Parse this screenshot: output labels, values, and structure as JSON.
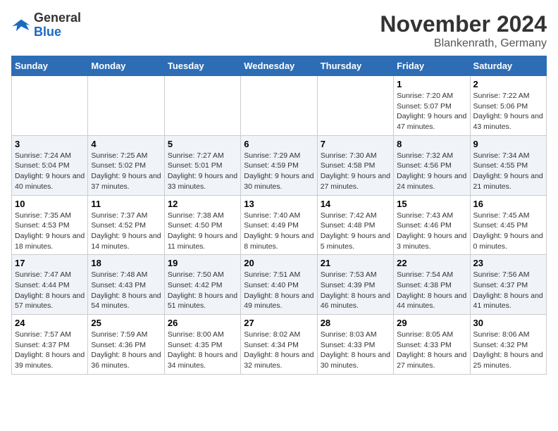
{
  "logo": {
    "general": "General",
    "blue": "Blue"
  },
  "header": {
    "month": "November 2024",
    "location": "Blankenrath, Germany"
  },
  "days_of_week": [
    "Sunday",
    "Monday",
    "Tuesday",
    "Wednesday",
    "Thursday",
    "Friday",
    "Saturday"
  ],
  "weeks": [
    [
      {
        "day": "",
        "info": ""
      },
      {
        "day": "",
        "info": ""
      },
      {
        "day": "",
        "info": ""
      },
      {
        "day": "",
        "info": ""
      },
      {
        "day": "",
        "info": ""
      },
      {
        "day": "1",
        "info": "Sunrise: 7:20 AM\nSunset: 5:07 PM\nDaylight: 9 hours and 47 minutes."
      },
      {
        "day": "2",
        "info": "Sunrise: 7:22 AM\nSunset: 5:06 PM\nDaylight: 9 hours and 43 minutes."
      }
    ],
    [
      {
        "day": "3",
        "info": "Sunrise: 7:24 AM\nSunset: 5:04 PM\nDaylight: 9 hours and 40 minutes."
      },
      {
        "day": "4",
        "info": "Sunrise: 7:25 AM\nSunset: 5:02 PM\nDaylight: 9 hours and 37 minutes."
      },
      {
        "day": "5",
        "info": "Sunrise: 7:27 AM\nSunset: 5:01 PM\nDaylight: 9 hours and 33 minutes."
      },
      {
        "day": "6",
        "info": "Sunrise: 7:29 AM\nSunset: 4:59 PM\nDaylight: 9 hours and 30 minutes."
      },
      {
        "day": "7",
        "info": "Sunrise: 7:30 AM\nSunset: 4:58 PM\nDaylight: 9 hours and 27 minutes."
      },
      {
        "day": "8",
        "info": "Sunrise: 7:32 AM\nSunset: 4:56 PM\nDaylight: 9 hours and 24 minutes."
      },
      {
        "day": "9",
        "info": "Sunrise: 7:34 AM\nSunset: 4:55 PM\nDaylight: 9 hours and 21 minutes."
      }
    ],
    [
      {
        "day": "10",
        "info": "Sunrise: 7:35 AM\nSunset: 4:53 PM\nDaylight: 9 hours and 18 minutes."
      },
      {
        "day": "11",
        "info": "Sunrise: 7:37 AM\nSunset: 4:52 PM\nDaylight: 9 hours and 14 minutes."
      },
      {
        "day": "12",
        "info": "Sunrise: 7:38 AM\nSunset: 4:50 PM\nDaylight: 9 hours and 11 minutes."
      },
      {
        "day": "13",
        "info": "Sunrise: 7:40 AM\nSunset: 4:49 PM\nDaylight: 9 hours and 8 minutes."
      },
      {
        "day": "14",
        "info": "Sunrise: 7:42 AM\nSunset: 4:48 PM\nDaylight: 9 hours and 5 minutes."
      },
      {
        "day": "15",
        "info": "Sunrise: 7:43 AM\nSunset: 4:46 PM\nDaylight: 9 hours and 3 minutes."
      },
      {
        "day": "16",
        "info": "Sunrise: 7:45 AM\nSunset: 4:45 PM\nDaylight: 9 hours and 0 minutes."
      }
    ],
    [
      {
        "day": "17",
        "info": "Sunrise: 7:47 AM\nSunset: 4:44 PM\nDaylight: 8 hours and 57 minutes."
      },
      {
        "day": "18",
        "info": "Sunrise: 7:48 AM\nSunset: 4:43 PM\nDaylight: 8 hours and 54 minutes."
      },
      {
        "day": "19",
        "info": "Sunrise: 7:50 AM\nSunset: 4:42 PM\nDaylight: 8 hours and 51 minutes."
      },
      {
        "day": "20",
        "info": "Sunrise: 7:51 AM\nSunset: 4:40 PM\nDaylight: 8 hours and 49 minutes."
      },
      {
        "day": "21",
        "info": "Sunrise: 7:53 AM\nSunset: 4:39 PM\nDaylight: 8 hours and 46 minutes."
      },
      {
        "day": "22",
        "info": "Sunrise: 7:54 AM\nSunset: 4:38 PM\nDaylight: 8 hours and 44 minutes."
      },
      {
        "day": "23",
        "info": "Sunrise: 7:56 AM\nSunset: 4:37 PM\nDaylight: 8 hours and 41 minutes."
      }
    ],
    [
      {
        "day": "24",
        "info": "Sunrise: 7:57 AM\nSunset: 4:37 PM\nDaylight: 8 hours and 39 minutes."
      },
      {
        "day": "25",
        "info": "Sunrise: 7:59 AM\nSunset: 4:36 PM\nDaylight: 8 hours and 36 minutes."
      },
      {
        "day": "26",
        "info": "Sunrise: 8:00 AM\nSunset: 4:35 PM\nDaylight: 8 hours and 34 minutes."
      },
      {
        "day": "27",
        "info": "Sunrise: 8:02 AM\nSunset: 4:34 PM\nDaylight: 8 hours and 32 minutes."
      },
      {
        "day": "28",
        "info": "Sunrise: 8:03 AM\nSunset: 4:33 PM\nDaylight: 8 hours and 30 minutes."
      },
      {
        "day": "29",
        "info": "Sunrise: 8:05 AM\nSunset: 4:33 PM\nDaylight: 8 hours and 27 minutes."
      },
      {
        "day": "30",
        "info": "Sunrise: 8:06 AM\nSunset: 4:32 PM\nDaylight: 8 hours and 25 minutes."
      }
    ]
  ]
}
